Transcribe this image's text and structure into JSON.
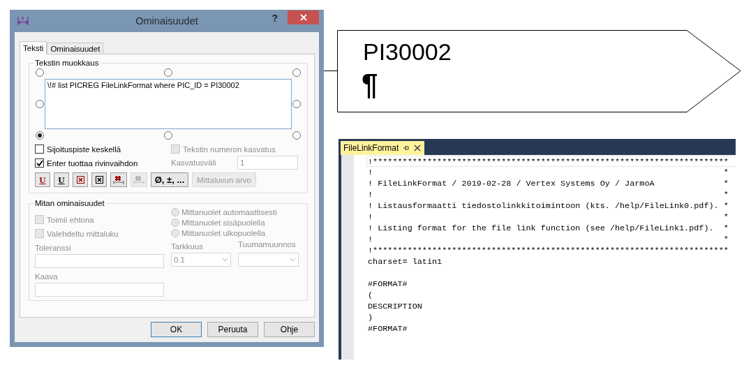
{
  "dialog": {
    "title": "Ominaisuudet",
    "help": "?",
    "tabs": [
      {
        "label": "Teksti",
        "selected": true
      },
      {
        "label": "Ominaisuudet",
        "selected": false
      }
    ],
    "text_group": {
      "legend": "Tekstin muokkaus",
      "text": "\\!# list PICREG FileLinkFormat where PIC_ID = PI30002",
      "anchors": [
        {
          "selected": false
        },
        {
          "selected": false
        },
        {
          "selected": false
        },
        {
          "selected": false
        },
        {
          "selected": false
        },
        {
          "selected": true
        },
        {
          "selected": false
        },
        {
          "selected": false
        }
      ],
      "options": [
        {
          "label": "Sijoituspiste keskellä",
          "checked": false,
          "disabled": false
        },
        {
          "label": "Enter tuottaa rivinvaihdon",
          "checked": true,
          "disabled": false
        }
      ],
      "numbering": {
        "label": "Tekstin numeron kasvatus",
        "checked": false,
        "disabled": true
      },
      "step": {
        "label": "Kasvatusväli",
        "value": "1",
        "disabled": true
      },
      "tools": [
        {
          "kind": "underline",
          "label": "U",
          "color": "#a00000",
          "disabled": false
        },
        {
          "kind": "underline",
          "label": "U",
          "color": "#000000",
          "disabled": false
        },
        {
          "kind": "boxx",
          "color": "#a00000",
          "disabled": false
        },
        {
          "kind": "boxx",
          "color": "#000000",
          "disabled": false
        },
        {
          "kind": "hash",
          "color": "#a00000",
          "disabled": false
        },
        {
          "kind": "hash",
          "disabled": true
        },
        {
          "kind": "text",
          "label": "Ø, ±, ...",
          "color": "#000000",
          "disabled": false
        },
        {
          "kind": "wide",
          "label": "Mittaluvun arvo",
          "disabled": true
        }
      ]
    },
    "dim_group": {
      "legend": "Mitan ominaisuudet",
      "options": [
        {
          "label": "Toimii ehtona",
          "checked": false,
          "disabled": true
        },
        {
          "label": "Valehdeltu mittaluku",
          "checked": false,
          "disabled": true
        }
      ],
      "arrows": [
        {
          "label": "Mittanuolet automaattisesti",
          "selected": false,
          "disabled": true
        },
        {
          "label": "Mittanuolet sisäpuolella",
          "selected": false,
          "disabled": true
        },
        {
          "label": "Mittanuolet ulkopuolella",
          "selected": false,
          "disabled": true
        }
      ],
      "tolerance": {
        "label": "Toleranssi",
        "disabled": true
      },
      "precision": {
        "label": "Tarkkuus",
        "value": "0.1",
        "disabled": true
      },
      "inch": {
        "label": "Tuumamuunnos",
        "disabled": true
      },
      "formula": {
        "label": "Kaava",
        "disabled": true
      }
    },
    "buttons": [
      {
        "label": "OK",
        "default": true
      },
      {
        "label": "Peruuta",
        "default": false
      },
      {
        "label": "Ohje",
        "default": false
      }
    ]
  },
  "tag": {
    "text": "PI30002",
    "mark": "¶"
  },
  "editor": {
    "tab": {
      "label": "FileLinkFormat",
      "selected": true
    },
    "lines": [
      {
        "kind": "code",
        "current": true,
        "text": "!************************************************************************"
      },
      {
        "kind": "code",
        "current": false,
        "text": "!                                                                       *"
      },
      {
        "kind": "code",
        "current": false,
        "text": "! FileLinkFormat / 2019-02-28 / Vertex Systems Oy / JarmoA              *"
      },
      {
        "kind": "code",
        "current": false,
        "text": "!                                                                       *"
      },
      {
        "kind": "code",
        "current": false,
        "text": "! Listausformaatti tiedostolinkkitoimintoon (kts. /help/FileLink0.pdf). *"
      },
      {
        "kind": "code",
        "current": false,
        "text": "!                                                                       *"
      },
      {
        "kind": "code",
        "current": false,
        "text": "! Listing format for the file link function (see /help/FileLink1.pdf).  *"
      },
      {
        "kind": "code",
        "current": false,
        "text": "!                                                                       *"
      },
      {
        "kind": "code",
        "current": false,
        "text": "!************************************************************************"
      },
      {
        "kind": "code",
        "current": false,
        "text": "charset= latin1"
      },
      {
        "kind": "blank",
        "current": false
      },
      {
        "kind": "code",
        "current": false,
        "text": "#FORMAT#"
      },
      {
        "kind": "code",
        "current": false,
        "text": "("
      },
      {
        "kind": "code",
        "current": false,
        "text": "DESCRIPTION"
      },
      {
        "kind": "code",
        "current": false,
        "text": ")"
      },
      {
        "kind": "code",
        "current": false,
        "text": "#FORMAT#"
      }
    ]
  }
}
